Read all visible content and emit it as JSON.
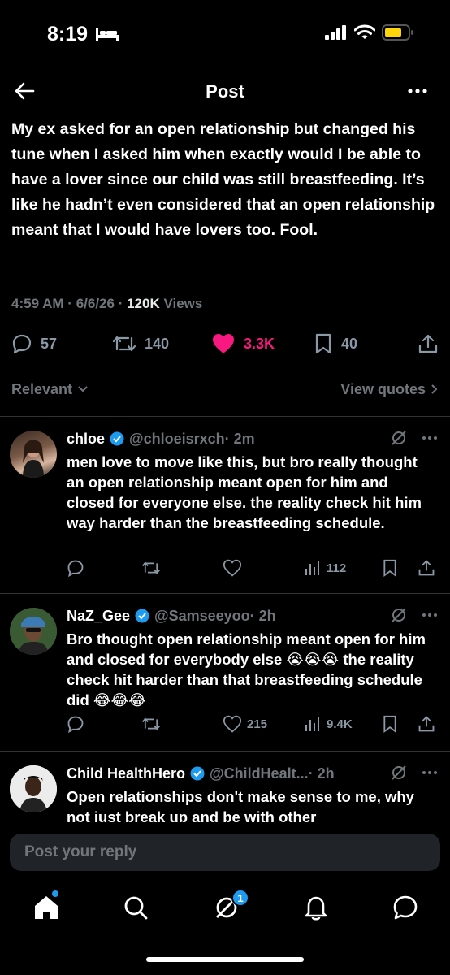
{
  "status_bar": {
    "time": "8:19"
  },
  "header": {
    "title": "Post"
  },
  "post": {
    "text": "My ex asked for an open relationship but changed his tune when I asked him when exactly would I be able to have a lover since our child was still breastfeeding. It’s like he hadn’t even considered that an open relationship meant that I would have lovers too. Fool.",
    "time": "4:59 AM",
    "date": "6/6/26",
    "views": "120K",
    "views_label": "Views",
    "replies": "57",
    "reposts": "140",
    "likes": "3.3K",
    "bookmarks": "40"
  },
  "sort": {
    "label": "Relevant",
    "quotes": "View quotes"
  },
  "replies": [
    {
      "name": "chloe",
      "handle": "@chloeisrxch",
      "time": "· 2m",
      "text": "men love to move like this, but bro really thought an open relationship meant open for him and closed for everyone else. the reality check hit him way harder than the breastfeeding schedule.",
      "likes": "",
      "views": "112"
    },
    {
      "name": "NaZ_Gee",
      "handle": "@Samseeyoo",
      "time": "· 2h",
      "text": "Bro thought open relationship meant open for him and closed for everybody else 😭😭😭 the reality check hit harder than that breastfeeding schedule did 😂😂😂",
      "likes": "215",
      "views": "9.4K"
    },
    {
      "name": "Child HealthHero",
      "handle": "@ChildHealt...",
      "time": "· 2h",
      "text": "Open relationships don't make sense to me, why not just break up and be with other"
    }
  ],
  "composer": {
    "placeholder": "Post your reply"
  },
  "nav": {
    "notifications_badge": "1"
  },
  "colors": {
    "accent": "#1d9bf0",
    "like": "#f91880",
    "muted": "#71767b",
    "battery": "#ffd60a"
  }
}
